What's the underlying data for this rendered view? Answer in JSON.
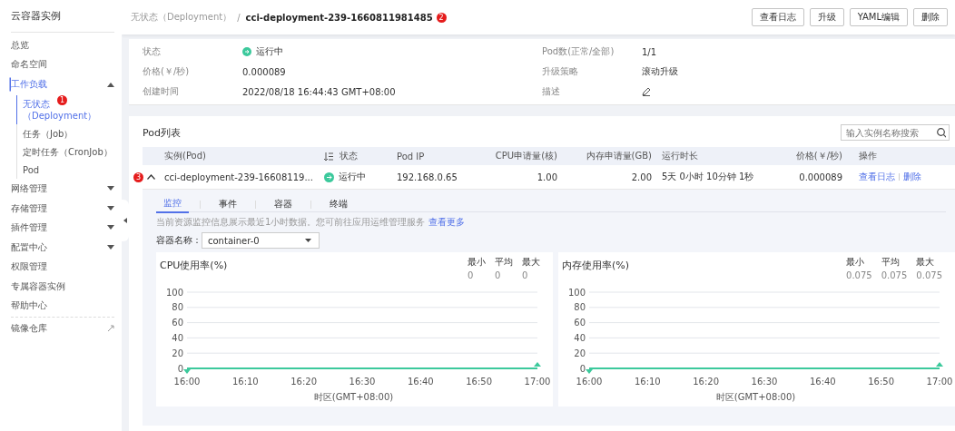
{
  "sidebar": {
    "title": "云容器实例",
    "items": [
      {
        "label": "总览",
        "kind": "plain",
        "selected": false
      },
      {
        "label": "命名空间",
        "kind": "plain",
        "selected": false
      },
      {
        "label": "工作负载",
        "kind": "group",
        "selected": true,
        "expanded": true,
        "children": [
          {
            "label": "无状态（Deployment）",
            "selected": true,
            "badge": "1"
          },
          {
            "label": "任务（Job）",
            "selected": false
          },
          {
            "label": "定时任务（CronJob）",
            "selected": false
          },
          {
            "label": "Pod",
            "selected": false
          }
        ]
      },
      {
        "label": "网络管理",
        "kind": "group",
        "selected": false,
        "expanded": false
      },
      {
        "label": "存储管理",
        "kind": "group",
        "selected": false,
        "expanded": false
      },
      {
        "label": "插件管理",
        "kind": "group",
        "selected": false,
        "expanded": false
      },
      {
        "label": "配置中心",
        "kind": "group",
        "selected": false,
        "expanded": false
      },
      {
        "label": "权限管理",
        "kind": "plain",
        "selected": false
      },
      {
        "label": "专属容器实例",
        "kind": "plain",
        "selected": false
      },
      {
        "label": "帮助中心",
        "kind": "plain",
        "selected": false
      },
      {
        "label": "镜像仓库",
        "kind": "external",
        "selected": false
      }
    ]
  },
  "breadcrumb": {
    "parent": "无状态（Deployment）",
    "separator": "/",
    "current": "cci-deployment-239-1660811981485",
    "badge": "2"
  },
  "actions": [
    "查看日志",
    "升级",
    "YAML编辑",
    "删除"
  ],
  "details": {
    "left": [
      {
        "label": "状态",
        "value": "运行中",
        "kind": "status"
      },
      {
        "label": "价格(￥/秒)",
        "value": "0.000089",
        "kind": "text"
      },
      {
        "label": "创建时间",
        "value": "2022/08/18 16:44:43 GMT+08:00",
        "kind": "text"
      }
    ],
    "right": [
      {
        "label": "Pod数(正常/全部)",
        "value": "1/1",
        "kind": "text"
      },
      {
        "label": "升级策略",
        "value": "滚动升级",
        "kind": "text"
      },
      {
        "label": "描述",
        "kind": "edit"
      }
    ]
  },
  "pod_list": {
    "title": "Pod列表",
    "search": {
      "placeholder": "输入实例名称搜索"
    },
    "columns": [
      "实例(Pod)",
      "状态",
      "Pod IP",
      "CPU申请量(核)",
      "内存申请量(GB)",
      "运行时长",
      "价格(￥/秒)",
      "操作"
    ],
    "rows": [
      {
        "badge": "3",
        "expanded": true,
        "name": "cci-deployment-239-16608119...",
        "status": "运行中",
        "ip": "192.168.0.65",
        "cpu": "1.00",
        "memory": "2.00",
        "uptime": "5天 0小时 10分钟 1秒",
        "price": "0.000089",
        "links": [
          "查看日志",
          "删除"
        ]
      }
    ],
    "tabs": [
      {
        "label": "监控",
        "selected": true
      },
      {
        "label": "事件",
        "selected": false
      },
      {
        "label": "容器",
        "selected": false
      },
      {
        "label": "终端",
        "selected": false
      }
    ],
    "info": "当前资源监控信息展示最近1小时数据。您可前往应用运维管理服务",
    "info_link": "查看更多",
    "container_label": "容器名称：",
    "container_value": "container-0",
    "charts": [
      {
        "stats": [
          {
            "label": "最小",
            "value": "0"
          },
          {
            "label": "平均",
            "value": "0"
          },
          {
            "label": "最大",
            "value": "0"
          }
        ],
        "chart_data": {
          "type": "line",
          "title": "CPU使用率(%)",
          "xlabel": "时区(GMT+08:00)",
          "categories": [
            "16:00",
            "16:10",
            "16:20",
            "16:30",
            "16:40",
            "16:50",
            "17:00"
          ],
          "ylim": [
            0,
            100
          ],
          "yticks": [
            0,
            20,
            40,
            60,
            80,
            100
          ],
          "grid": true,
          "series": [
            {
              "color": "#3cc99c",
              "values": [
                0,
                0,
                0,
                0,
                0,
                0,
                0
              ]
            }
          ]
        }
      },
      {
        "stats": [
          {
            "label": "最小",
            "value": "0.075"
          },
          {
            "label": "平均",
            "value": "0.075"
          },
          {
            "label": "最大",
            "value": "0.075"
          }
        ],
        "chart_data": {
          "type": "line",
          "title": "内存使用率(%)",
          "xlabel": "时区(GMT+08:00)",
          "categories": [
            "16:00",
            "16:10",
            "16:20",
            "16:30",
            "16:40",
            "16:50",
            "17:00"
          ],
          "ylim": [
            0,
            100
          ],
          "yticks": [
            0,
            20,
            40,
            60,
            80,
            100
          ],
          "grid": true,
          "series": [
            {
              "color": "#3cc99c",
              "values": [
                0,
                0,
                0,
                0,
                0,
                0,
                0
              ]
            }
          ]
        }
      }
    ]
  }
}
